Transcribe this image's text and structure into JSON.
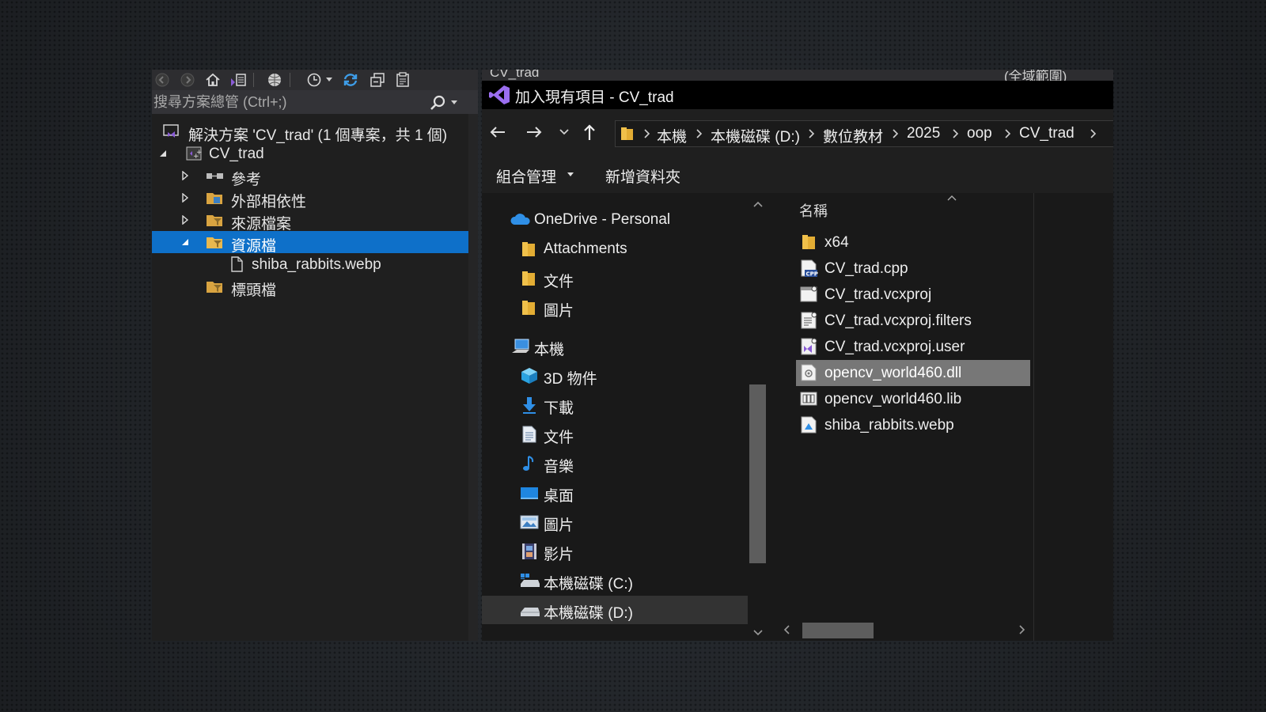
{
  "solution_explorer": {
    "search_placeholder": "搜尋方案總管 (Ctrl+;)",
    "tree": {
      "solution_label": "解決方案 'CV_trad' (1 個專案，共 1 個)",
      "project_label": "CV_trad",
      "references_label": "參考",
      "external_deps_label": "外部相依性",
      "source_files_label": "來源檔案",
      "resource_files_label": "資源檔",
      "resource_child_label": "shiba_rabbits.webp",
      "header_files_label": "標頭檔"
    }
  },
  "dialog": {
    "underlying_tab_left": "CV_trad",
    "underlying_tab_right": "(全域範圍)",
    "title": "加入現有項目 - CV_trad",
    "breadcrumb": [
      "本機",
      "本機磁碟 (D:)",
      "數位教材",
      "2025",
      "oop",
      "CV_trad"
    ],
    "commands": {
      "organize_label": "組合管理",
      "new_folder_label": "新增資料夾"
    },
    "nav": {
      "onedrive": "OneDrive - Personal",
      "attachments": "Attachments",
      "od_documents": "文件",
      "od_pictures": "圖片",
      "this_pc": "本機",
      "objects_3d": "3D 物件",
      "downloads": "下載",
      "documents": "文件",
      "music": "音樂",
      "desktop": "桌面",
      "pictures": "圖片",
      "videos": "影片",
      "drive_c": "本機磁碟 (C:)",
      "drive_d": "本機磁碟 (D:)"
    },
    "column_name_label": "名稱",
    "files": [
      {
        "name": "x64",
        "icon": "folder-icon"
      },
      {
        "name": "CV_trad.cpp",
        "icon": "cpp-file-icon"
      },
      {
        "name": "CV_trad.vcxproj",
        "icon": "vcxproj-file-icon"
      },
      {
        "name": "CV_trad.vcxproj.filters",
        "icon": "filters-file-icon"
      },
      {
        "name": "CV_trad.vcxproj.user",
        "icon": "user-file-icon"
      },
      {
        "name": "opencv_world460.dll",
        "icon": "dll-file-icon"
      },
      {
        "name": "opencv_world460.lib",
        "icon": "lib-file-icon"
      },
      {
        "name": "shiba_rabbits.webp",
        "icon": "webp-file-icon"
      }
    ],
    "selected_file": "opencv_world460.dll"
  },
  "colors": {
    "selection_blue": "#0e70c9",
    "vs_purple": "#8a5cd6",
    "folder_yellow": "#f0c04a"
  }
}
